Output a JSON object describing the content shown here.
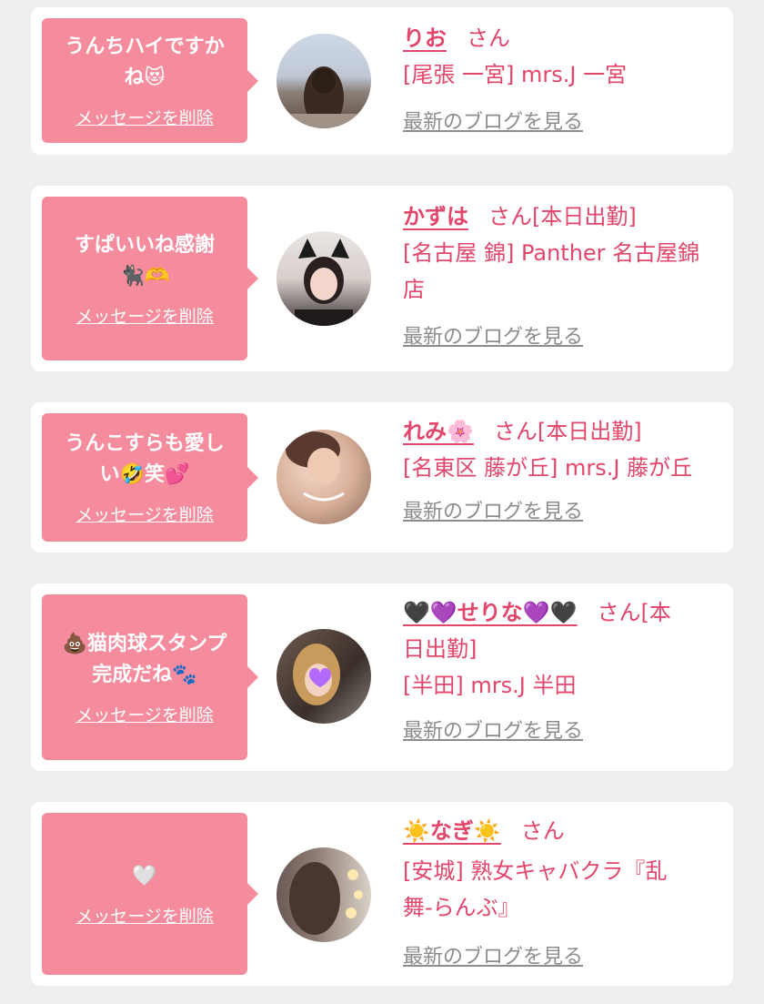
{
  "common": {
    "delete_label": "メッセージを削除",
    "blog_label": "最新のブログを見る",
    "san": "さん"
  },
  "cards": [
    {
      "message_line1": "うんちハイですか",
      "message_line2": "ね😻",
      "name": "りお",
      "suffix": "さん",
      "shop": "[尾張 一宮] mrs.J 一宮"
    },
    {
      "message_line1": "すぱいいね感謝",
      "message_line2": "🐈‍⬛🫶",
      "name": "かずは",
      "suffix": "さん[本日出勤]",
      "shop_line1": "[名古屋 錦] Panther 名古屋錦",
      "shop_line2": "店"
    },
    {
      "message_line1": "うんこすらも愛し",
      "message_line2": "い🤣笑💕",
      "name": "れみ🌸",
      "suffix": "さん[本日出勤]",
      "shop": "[名東区 藤が丘] mrs.J 藤が丘"
    },
    {
      "message_line1": "💩猫肉球スタンプ",
      "message_line2": "完成だね🐾",
      "name": "🖤💜せりな💜🖤",
      "suffix_line1": "さん[本",
      "suffix_line2": "日出勤]",
      "shop": "[半田] mrs.J 半田"
    },
    {
      "message_line1": "🤍",
      "name": "☀️なぎ☀️",
      "suffix": "さん",
      "shop_line1": "[安城] 熟女キャバクラ『乱",
      "shop_line2": "舞-らんぶ』"
    }
  ],
  "colors": {
    "background": "#eeeeee",
    "card": "#ffffff",
    "bubble": "#f58c9d",
    "accent": "#e2466a",
    "link_gray": "#8c8c8c"
  },
  "icons": [
    "avatar-photo"
  ]
}
